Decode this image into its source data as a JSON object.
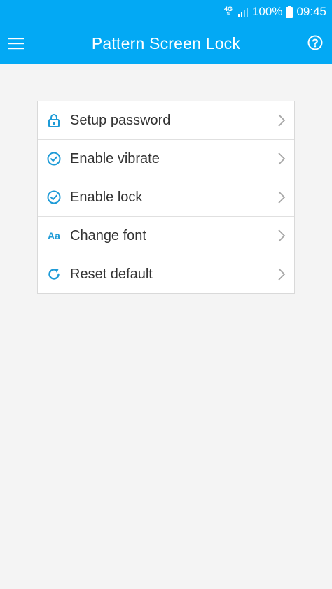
{
  "status_bar": {
    "network_type": "4G",
    "battery": "100%",
    "time": "09:45"
  },
  "app_bar": {
    "title": "Pattern Screen Lock",
    "menu_icon": "hamburger-menu-icon",
    "help_icon": "help-circle-icon"
  },
  "settings": {
    "items": [
      {
        "label": "Setup password",
        "icon": "lock-icon"
      },
      {
        "label": "Enable vibrate",
        "icon": "check-circle-icon"
      },
      {
        "label": "Enable lock",
        "icon": "check-circle-icon"
      },
      {
        "label": "Change font",
        "icon_text": "Aa"
      },
      {
        "label": "Reset default",
        "icon": "refresh-icon"
      }
    ]
  },
  "colors": {
    "primary": "#03a9f4",
    "icon_accent": "#1e9bd7",
    "background": "#f4f4f4"
  }
}
